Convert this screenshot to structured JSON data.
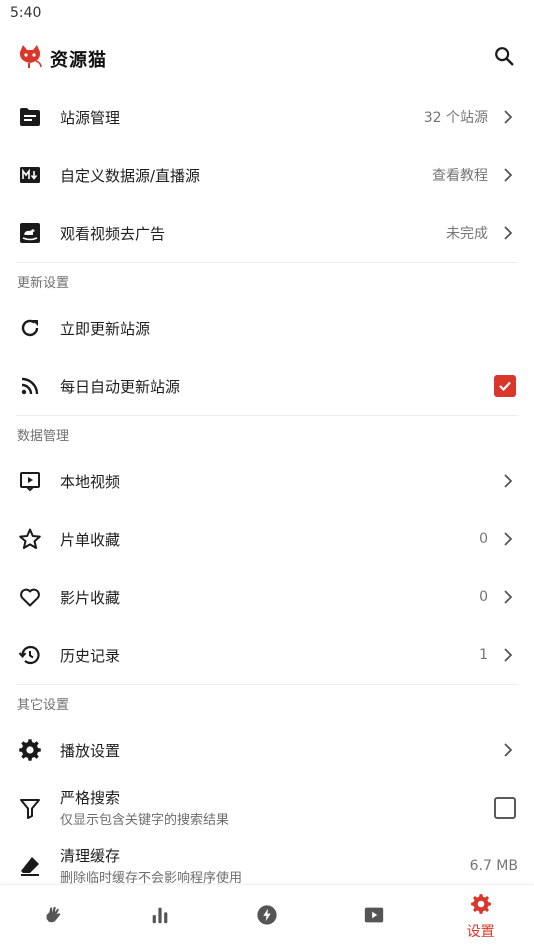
{
  "status_bar": {
    "time": "5:40"
  },
  "app_bar": {
    "title": "资源猫",
    "search_icon": "search-icon"
  },
  "rows_top": [
    {
      "name": "site-source-management",
      "icon": "folder-icon",
      "label": "站源管理",
      "value": "32 个站源",
      "chevron": true
    },
    {
      "name": "custom-data-source",
      "icon": "markdown-icon",
      "label": "自定义数据源/直播源",
      "value": "查看教程",
      "chevron": true
    },
    {
      "name": "watch-video-remove-ads",
      "icon": "rocking-horse-icon",
      "label": "观看视频去广告",
      "value": "未完成",
      "chevron": true
    }
  ],
  "sections": {
    "update": {
      "header": "更新设置",
      "update_now": {
        "label": "立即更新站源"
      },
      "auto_update": {
        "label": "每日自动更新站源",
        "checked": true
      }
    },
    "data": {
      "header": "数据管理",
      "local_video": {
        "label": "本地视频"
      },
      "playlist_fav": {
        "label": "片单收藏",
        "value": "0"
      },
      "movie_fav": {
        "label": "影片收藏",
        "value": "0"
      },
      "history": {
        "label": "历史记录",
        "value": "1"
      }
    },
    "other": {
      "header": "其它设置",
      "playback": {
        "label": "播放设置"
      },
      "strict_search": {
        "label": "严格搜索",
        "sublabel": "仅显示包含关键字的搜索结果",
        "checked": false
      },
      "clear_cache": {
        "label": "清理缓存",
        "sublabel": "删除临时缓存不会影响程序使用",
        "value": "6.7 MB"
      }
    }
  },
  "bottom_nav": {
    "items": [
      {
        "name": "nav-home",
        "icon": "hand-icon",
        "label": ""
      },
      {
        "name": "nav-rank",
        "icon": "bar-chart-icon",
        "label": ""
      },
      {
        "name": "nav-flash",
        "icon": "bolt-icon",
        "label": ""
      },
      {
        "name": "nav-video",
        "icon": "video-icon",
        "label": ""
      },
      {
        "name": "nav-settings",
        "icon": "gear-icon",
        "label": "设置"
      }
    ],
    "active_index": 4
  },
  "colors": {
    "accent": "#d9372b",
    "text": "#1e1e1e",
    "secondary": "#767676"
  }
}
